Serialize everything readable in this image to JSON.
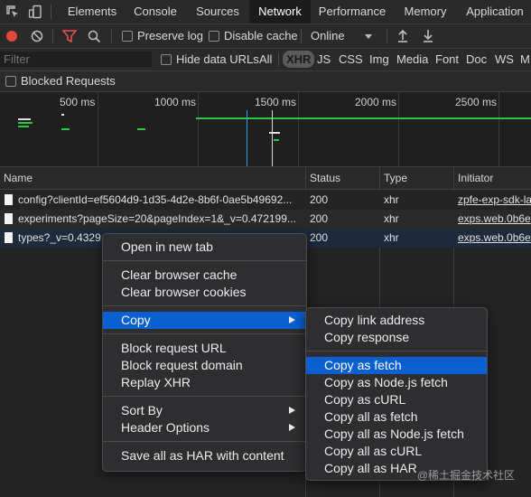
{
  "tabs": [
    "Elements",
    "Console",
    "Sources",
    "Network",
    "Performance",
    "Memory",
    "Application"
  ],
  "active_tab": "Network",
  "toolbar": {
    "preserve_log": "Preserve log",
    "disable_cache": "Disable cache",
    "throttle": "Online"
  },
  "filter": {
    "placeholder": "Filter",
    "hide_data_urls": "Hide data URLs",
    "types": [
      "All",
      "XHR",
      "JS",
      "CSS",
      "Img",
      "Media",
      "Font",
      "Doc",
      "WS",
      "M"
    ],
    "active_type": "XHR",
    "blocked_requests": "Blocked Requests"
  },
  "overview": {
    "ticks": [
      "500 ms",
      "1000 ms",
      "1500 ms",
      "2000 ms",
      "2500 ms"
    ]
  },
  "table": {
    "columns": [
      "Name",
      "Status",
      "Type",
      "Initiator"
    ],
    "rows": [
      {
        "name": "config?clientId=ef5604d9-1d35-4d2e-8b6f-0ae5b49692...",
        "status": "200",
        "type": "xhr",
        "initiator": "zpfe-exp-sdk-la"
      },
      {
        "name": "experiments?pageSize=20&pageIndex=1&_v=0.472199...",
        "status": "200",
        "type": "xhr",
        "initiator": "exps.web.0b6e"
      },
      {
        "name": "types?_v=0.4329",
        "status": "200",
        "type": "xhr",
        "initiator": "exps.web.0b6e"
      }
    ]
  },
  "context_menu": {
    "open_new_tab": "Open in new tab",
    "clear_cache": "Clear browser cache",
    "clear_cookies": "Clear browser cookies",
    "copy": "Copy",
    "block_url": "Block request URL",
    "block_domain": "Block request domain",
    "replay": "Replay XHR",
    "sort_by": "Sort By",
    "header_options": "Header Options",
    "save_har": "Save all as HAR with content"
  },
  "copy_submenu": {
    "link_address": "Copy link address",
    "response": "Copy response",
    "as_fetch": "Copy as fetch",
    "as_node_fetch": "Copy as Node.js fetch",
    "as_curl": "Copy as cURL",
    "all_as_fetch": "Copy all as fetch",
    "all_as_node_fetch": "Copy all as Node.js fetch",
    "all_as_curl": "Copy all as cURL",
    "all_as_har": "Copy all as HAR"
  },
  "watermark": "@稀土掘金技术社区",
  "colors": {
    "accent": "#0a5fd1",
    "record": "#e4473b",
    "filter_icon": "#e8534a",
    "waterfall_green": "#27c93f",
    "waterfall_blue": "#3aa0e6"
  }
}
